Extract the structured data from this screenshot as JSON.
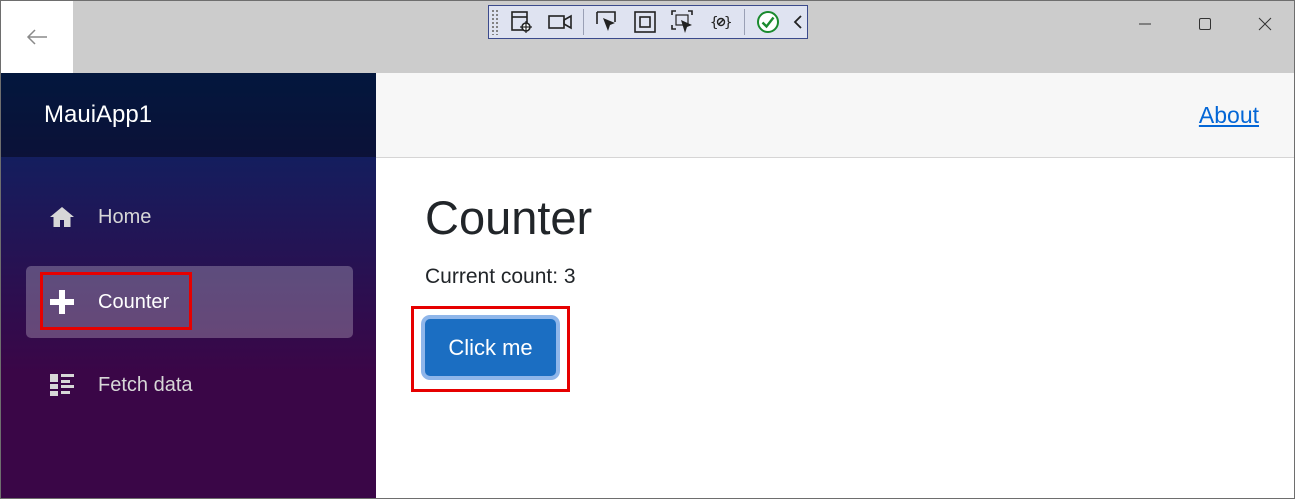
{
  "app": {
    "title": "MauiApp1"
  },
  "header": {
    "about_label": "About"
  },
  "sidebar": {
    "items": [
      {
        "label": "Home",
        "icon": "home-icon"
      },
      {
        "label": "Counter",
        "icon": "plus-icon"
      },
      {
        "label": "Fetch data",
        "icon": "list-icon"
      }
    ],
    "active": "Counter"
  },
  "main": {
    "title": "Counter",
    "count_text": "Current count: 3",
    "button_label": "Click me"
  },
  "debug_toolbar": {
    "icons": [
      "grip-icon",
      "live-visual-tree-icon",
      "record-icon",
      "select-element-icon",
      "display-layout-adorners-icon",
      "track-focus-icon",
      "binding-failures-icon",
      "hot-reload-check-icon",
      "collapse-chevron-icon"
    ]
  },
  "window_controls": [
    "minimize-icon",
    "maximize-icon",
    "close-icon"
  ],
  "colors": {
    "sidebar_top": "#052767",
    "sidebar_bottom": "#3a0647",
    "button": "#1b6ec2",
    "link": "#0366d6",
    "highlight": "#e60000"
  }
}
